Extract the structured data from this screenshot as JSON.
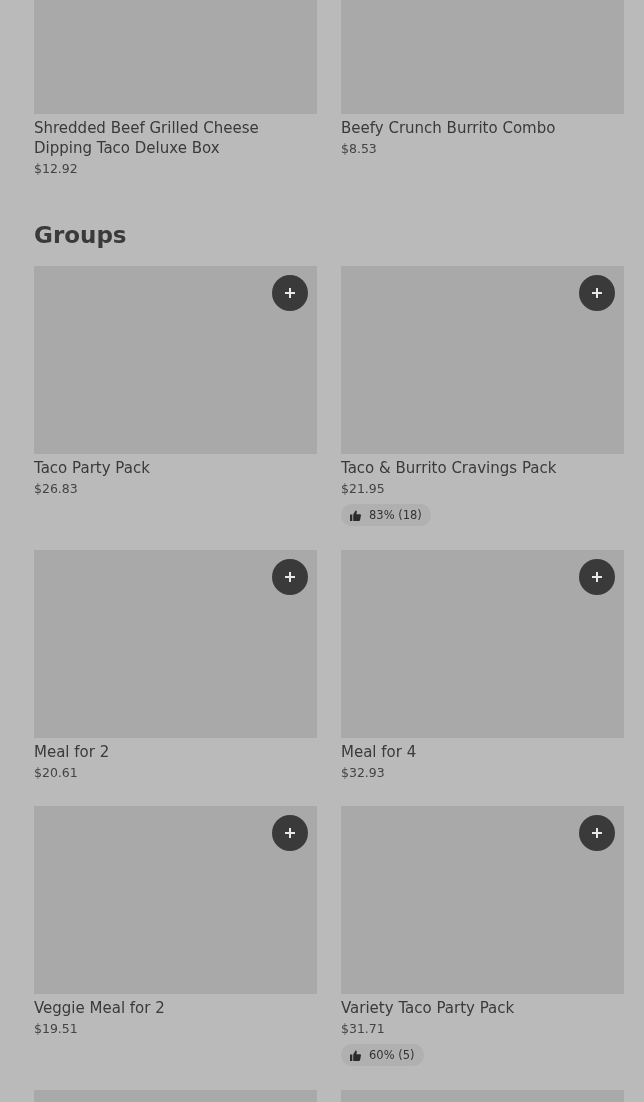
{
  "top_items": [
    {
      "kind": "item",
      "title": "Shredded Beef Grilled Cheese Dipping Taco Deluxe Box",
      "price": "$12.92"
    },
    {
      "kind": "item",
      "title": "Beefy Crunch Burrito Combo",
      "price": "$8.53"
    }
  ],
  "groups": {
    "heading": "Groups",
    "items": [
      {
        "kind": "item",
        "title": "Taco Party Pack",
        "price": "$26.83"
      },
      {
        "kind": "item",
        "title": "Taco & Burrito Cravings Pack",
        "price": "$21.95",
        "rating": "83% (18)"
      },
      {
        "kind": "item",
        "title": "Meal for 2",
        "price": "$20.61"
      },
      {
        "kind": "item",
        "title": "Meal for 4",
        "price": "$32.93"
      },
      {
        "kind": "item",
        "title": "Veggie Meal for 2",
        "price": "$19.51"
      },
      {
        "kind": "item",
        "title": "Variety Taco Party Pack",
        "price": "$31.71",
        "rating": "60% (5)"
      },
      {
        "kind": "partial"
      },
      {
        "kind": "partial"
      }
    ]
  }
}
